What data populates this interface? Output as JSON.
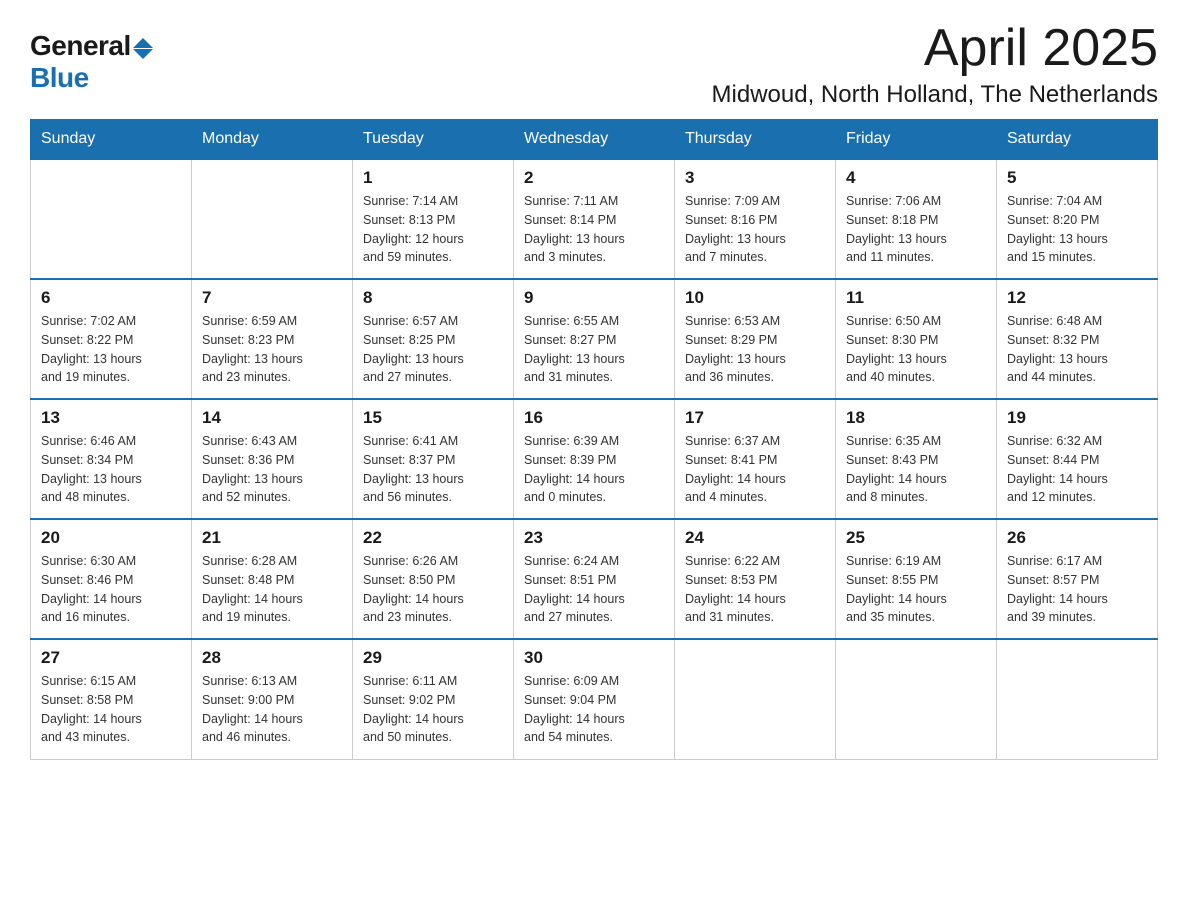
{
  "logo": {
    "general": "General",
    "blue": "Blue",
    "triangle": "▶"
  },
  "title": {
    "month": "April 2025",
    "location": "Midwoud, North Holland, The Netherlands"
  },
  "weekdays": [
    "Sunday",
    "Monday",
    "Tuesday",
    "Wednesday",
    "Thursday",
    "Friday",
    "Saturday"
  ],
  "weeks": [
    [
      {
        "day": "",
        "info": ""
      },
      {
        "day": "",
        "info": ""
      },
      {
        "day": "1",
        "info": "Sunrise: 7:14 AM\nSunset: 8:13 PM\nDaylight: 12 hours\nand 59 minutes."
      },
      {
        "day": "2",
        "info": "Sunrise: 7:11 AM\nSunset: 8:14 PM\nDaylight: 13 hours\nand 3 minutes."
      },
      {
        "day": "3",
        "info": "Sunrise: 7:09 AM\nSunset: 8:16 PM\nDaylight: 13 hours\nand 7 minutes."
      },
      {
        "day": "4",
        "info": "Sunrise: 7:06 AM\nSunset: 8:18 PM\nDaylight: 13 hours\nand 11 minutes."
      },
      {
        "day": "5",
        "info": "Sunrise: 7:04 AM\nSunset: 8:20 PM\nDaylight: 13 hours\nand 15 minutes."
      }
    ],
    [
      {
        "day": "6",
        "info": "Sunrise: 7:02 AM\nSunset: 8:22 PM\nDaylight: 13 hours\nand 19 minutes."
      },
      {
        "day": "7",
        "info": "Sunrise: 6:59 AM\nSunset: 8:23 PM\nDaylight: 13 hours\nand 23 minutes."
      },
      {
        "day": "8",
        "info": "Sunrise: 6:57 AM\nSunset: 8:25 PM\nDaylight: 13 hours\nand 27 minutes."
      },
      {
        "day": "9",
        "info": "Sunrise: 6:55 AM\nSunset: 8:27 PM\nDaylight: 13 hours\nand 31 minutes."
      },
      {
        "day": "10",
        "info": "Sunrise: 6:53 AM\nSunset: 8:29 PM\nDaylight: 13 hours\nand 36 minutes."
      },
      {
        "day": "11",
        "info": "Sunrise: 6:50 AM\nSunset: 8:30 PM\nDaylight: 13 hours\nand 40 minutes."
      },
      {
        "day": "12",
        "info": "Sunrise: 6:48 AM\nSunset: 8:32 PM\nDaylight: 13 hours\nand 44 minutes."
      }
    ],
    [
      {
        "day": "13",
        "info": "Sunrise: 6:46 AM\nSunset: 8:34 PM\nDaylight: 13 hours\nand 48 minutes."
      },
      {
        "day": "14",
        "info": "Sunrise: 6:43 AM\nSunset: 8:36 PM\nDaylight: 13 hours\nand 52 minutes."
      },
      {
        "day": "15",
        "info": "Sunrise: 6:41 AM\nSunset: 8:37 PM\nDaylight: 13 hours\nand 56 minutes."
      },
      {
        "day": "16",
        "info": "Sunrise: 6:39 AM\nSunset: 8:39 PM\nDaylight: 14 hours\nand 0 minutes."
      },
      {
        "day": "17",
        "info": "Sunrise: 6:37 AM\nSunset: 8:41 PM\nDaylight: 14 hours\nand 4 minutes."
      },
      {
        "day": "18",
        "info": "Sunrise: 6:35 AM\nSunset: 8:43 PM\nDaylight: 14 hours\nand 8 minutes."
      },
      {
        "day": "19",
        "info": "Sunrise: 6:32 AM\nSunset: 8:44 PM\nDaylight: 14 hours\nand 12 minutes."
      }
    ],
    [
      {
        "day": "20",
        "info": "Sunrise: 6:30 AM\nSunset: 8:46 PM\nDaylight: 14 hours\nand 16 minutes."
      },
      {
        "day": "21",
        "info": "Sunrise: 6:28 AM\nSunset: 8:48 PM\nDaylight: 14 hours\nand 19 minutes."
      },
      {
        "day": "22",
        "info": "Sunrise: 6:26 AM\nSunset: 8:50 PM\nDaylight: 14 hours\nand 23 minutes."
      },
      {
        "day": "23",
        "info": "Sunrise: 6:24 AM\nSunset: 8:51 PM\nDaylight: 14 hours\nand 27 minutes."
      },
      {
        "day": "24",
        "info": "Sunrise: 6:22 AM\nSunset: 8:53 PM\nDaylight: 14 hours\nand 31 minutes."
      },
      {
        "day": "25",
        "info": "Sunrise: 6:19 AM\nSunset: 8:55 PM\nDaylight: 14 hours\nand 35 minutes."
      },
      {
        "day": "26",
        "info": "Sunrise: 6:17 AM\nSunset: 8:57 PM\nDaylight: 14 hours\nand 39 minutes."
      }
    ],
    [
      {
        "day": "27",
        "info": "Sunrise: 6:15 AM\nSunset: 8:58 PM\nDaylight: 14 hours\nand 43 minutes."
      },
      {
        "day": "28",
        "info": "Sunrise: 6:13 AM\nSunset: 9:00 PM\nDaylight: 14 hours\nand 46 minutes."
      },
      {
        "day": "29",
        "info": "Sunrise: 6:11 AM\nSunset: 9:02 PM\nDaylight: 14 hours\nand 50 minutes."
      },
      {
        "day": "30",
        "info": "Sunrise: 6:09 AM\nSunset: 9:04 PM\nDaylight: 14 hours\nand 54 minutes."
      },
      {
        "day": "",
        "info": ""
      },
      {
        "day": "",
        "info": ""
      },
      {
        "day": "",
        "info": ""
      }
    ]
  ]
}
